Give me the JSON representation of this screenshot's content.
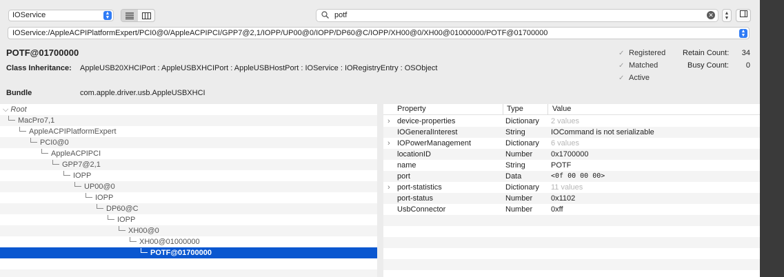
{
  "toolbar": {
    "service_select": "IOService",
    "search_query": "potf"
  },
  "path": "IOService:/AppleACPIPlatformExpert/PCI0@0/AppleACPIPCI/GPP7@2,1/IOPP/UP00@0/IOPP/DP60@C/IOPP/XH00@0/XH00@01000000/POTF@01700000",
  "object": {
    "title": "POTF@01700000",
    "class_inheritance_label": "Class Inheritance:",
    "class_inheritance": "AppleUSB20XHCIPort : AppleUSBXHCIPort : AppleUSBHostPort : IOService : IORegistryEntry : OSObject",
    "bundle_label": "Bundle",
    "bundle": "com.apple.driver.usb.AppleUSBXHCI",
    "checks": [
      {
        "label": "Registered",
        "checked": true
      },
      {
        "label": "Matched",
        "checked": true
      },
      {
        "label": "Active",
        "checked": true
      }
    ],
    "retain_label": "Retain Count:",
    "retain_value": "34",
    "busy_label": "Busy Count:",
    "busy_value": "0"
  },
  "tree": [
    {
      "label": "Root",
      "depth": 0,
      "italic": true
    },
    {
      "label": "MacPro7,1",
      "depth": 1
    },
    {
      "label": "AppleACPIPlatformExpert",
      "depth": 2
    },
    {
      "label": "PCI0@0",
      "depth": 3
    },
    {
      "label": "AppleACPIPCI",
      "depth": 4
    },
    {
      "label": "GPP7@2,1",
      "depth": 5
    },
    {
      "label": "IOPP",
      "depth": 6
    },
    {
      "label": "UP00@0",
      "depth": 7
    },
    {
      "label": "IOPP",
      "depth": 8
    },
    {
      "label": "DP60@C",
      "depth": 9
    },
    {
      "label": "IOPP",
      "depth": 10
    },
    {
      "label": "XH00@0",
      "depth": 11
    },
    {
      "label": "XH00@01000000",
      "depth": 12
    },
    {
      "label": "POTF@01700000",
      "depth": 13,
      "selected": true
    }
  ],
  "properties": {
    "headers": [
      "Property",
      "Type",
      "Value"
    ],
    "rows": [
      {
        "name": "device-properties",
        "type": "Dictionary",
        "value": "2 values",
        "expandable": true,
        "dim": true
      },
      {
        "name": "IOGeneralInterest",
        "type": "String",
        "value": "IOCommand is not serializable"
      },
      {
        "name": "IOPowerManagement",
        "type": "Dictionary",
        "value": "6 values",
        "expandable": true,
        "dim": true
      },
      {
        "name": "locationID",
        "type": "Number",
        "value": "0x1700000"
      },
      {
        "name": "name",
        "type": "String",
        "value": "POTF"
      },
      {
        "name": "port",
        "type": "Data",
        "value": "<0f 00 00 00>",
        "mono": true
      },
      {
        "name": "port-statistics",
        "type": "Dictionary",
        "value": "11 values",
        "expandable": true,
        "dim": true
      },
      {
        "name": "port-status",
        "type": "Number",
        "value": "0x1102"
      },
      {
        "name": "UsbConnector",
        "type": "Number",
        "value": "0xff"
      }
    ]
  }
}
